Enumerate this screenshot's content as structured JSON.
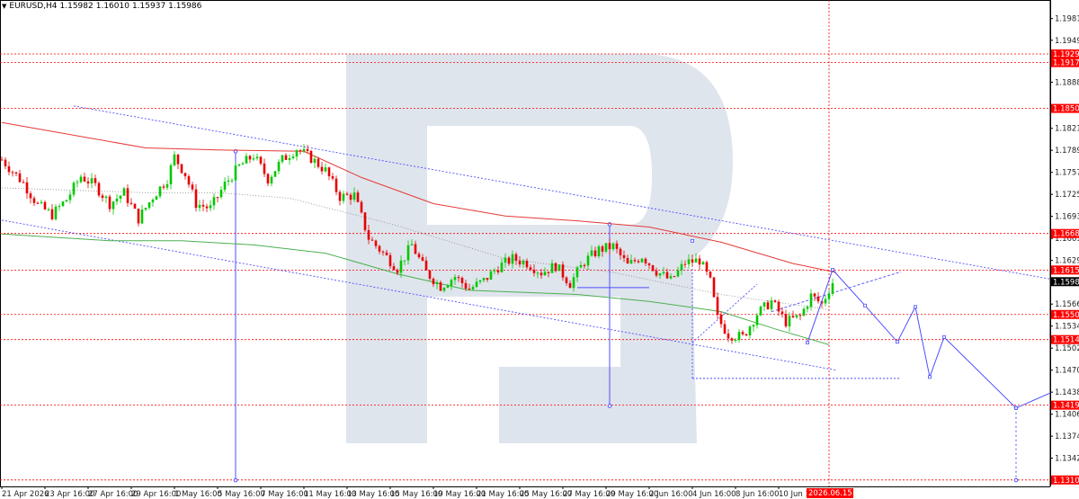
{
  "header": {
    "symbol": "EURUSD,H4",
    "open": "1.15982",
    "high": "1.16010",
    "low": "1.15937",
    "close": "1.15986"
  },
  "colors": {
    "bull": "#00c800",
    "bear": "#e60000",
    "ma_red": "#e53935",
    "ma_green": "#4caf50",
    "forecast": "#4d4dff",
    "level": "#ff0000",
    "watermark": "#d9e0ea",
    "grid": "#000000"
  },
  "icons": {
    "menu": "triangle-down-icon",
    "watermark": "logo-r-icon"
  },
  "chart_data": {
    "type": "candlestick",
    "y_ticks": [
      "1.19810",
      "1.19495",
      "1.18885",
      "1.18215",
      "1.17895",
      "1.17575",
      "1.17255",
      "1.16935",
      "1.16615",
      "1.16295",
      "1.15660",
      "1.15340",
      "1.15020",
      "1.14700",
      "1.14380",
      "1.14060",
      "1.13740",
      "1.13420",
      "1.13100"
    ],
    "y_tick_values": [
      1.1981,
      1.19495,
      1.18885,
      1.18215,
      1.17895,
      1.17575,
      1.17255,
      1.16935,
      1.16615,
      1.16295,
      1.1566,
      1.1534,
      1.1502,
      1.147,
      1.1438,
      1.1406,
      1.1374,
      1.1342,
      1.131
    ],
    "x_ticks": [
      "21 Apr 2026",
      "23 Apr 16:00",
      "27 Apr 16:00",
      "29 Apr 16:00",
      "1 May 16:00",
      "5 May 16:00",
      "7 May 16:00",
      "11 May 16:00",
      "13 May 16:00",
      "15 May 16:00",
      "19 May 16:00",
      "21 May 16:00",
      "25 May 16:00",
      "27 May 16:00",
      "29 May 16:00",
      "2 Jun 16:00",
      "4 Jun 16:00",
      "8 Jun 16:00",
      "10 Jun 16:00"
    ],
    "x_tick_bars": [
      0,
      12,
      24,
      36,
      48,
      60,
      72,
      84,
      96,
      108,
      120,
      132,
      144,
      156,
      168,
      180,
      192,
      204,
      216
    ],
    "cursor_label": "2026.06.15 00:00",
    "cursor_bar": 230,
    "levels": [
      {
        "price": 1.19296,
        "label": "1.19296"
      },
      {
        "price": 1.1917,
        "label": "1.19170"
      },
      {
        "price": 1.18504,
        "label": "1.18504"
      },
      {
        "price": 1.16686,
        "label": "1.16686"
      },
      {
        "price": 1.16155,
        "label": "1.16155"
      },
      {
        "price": 1.15509,
        "label": "1.15509"
      },
      {
        "price": 1.15144,
        "label": "1.15144"
      },
      {
        "price": 1.14191,
        "label": "1.14191"
      },
      {
        "price": 1.13104,
        "label": "1.13104"
      }
    ],
    "current_price": {
      "price": 1.15986,
      "label": "1.15986"
    },
    "ylim": [
      1.1301,
      1.2008
    ],
    "bars_visible": 292,
    "key_closes": [
      [
        0,
        1.1776
      ],
      [
        6,
        1.1742
      ],
      [
        10,
        1.171
      ],
      [
        14,
        1.1696
      ],
      [
        18,
        1.1718
      ],
      [
        22,
        1.1752
      ],
      [
        26,
        1.1738
      ],
      [
        30,
        1.1712
      ],
      [
        34,
        1.1728
      ],
      [
        38,
        1.169
      ],
      [
        42,
        1.1722
      ],
      [
        46,
        1.1748
      ],
      [
        48,
        1.178
      ],
      [
        51,
        1.1755
      ],
      [
        54,
        1.1712
      ],
      [
        58,
        1.1705
      ],
      [
        62,
        1.174
      ],
      [
        66,
        1.1766
      ],
      [
        70,
        1.1782
      ],
      [
        74,
        1.1748
      ],
      [
        78,
        1.1776
      ],
      [
        82,
        1.1792
      ],
      [
        86,
        1.1778
      ],
      [
        90,
        1.176
      ],
      [
        94,
        1.1722
      ],
      [
        98,
        1.1724
      ],
      [
        102,
        1.1662
      ],
      [
        106,
        1.164
      ],
      [
        110,
        1.1618
      ],
      [
        114,
        1.1652
      ],
      [
        118,
        1.1612
      ],
      [
        122,
        1.1592
      ],
      [
        126,
        1.1606
      ],
      [
        130,
        1.1588
      ],
      [
        134,
        1.16
      ],
      [
        138,
        1.162
      ],
      [
        142,
        1.1632
      ],
      [
        146,
        1.1626
      ],
      [
        150,
        1.1612
      ],
      [
        154,
        1.1622
      ],
      [
        158,
        1.1596
      ],
      [
        162,
        1.1628
      ],
      [
        166,
        1.1645
      ],
      [
        170,
        1.165
      ],
      [
        174,
        1.1622
      ],
      [
        178,
        1.1636
      ],
      [
        182,
        1.1614
      ],
      [
        186,
        1.16
      ],
      [
        190,
        1.1626
      ],
      [
        194,
        1.163
      ],
      [
        197,
        1.1598
      ],
      [
        199,
        1.1545
      ],
      [
        202,
        1.1522
      ],
      [
        206,
        1.1518
      ],
      [
        210,
        1.1552
      ],
      [
        214,
        1.157
      ],
      [
        218,
        1.154
      ],
      [
        222,
        1.1548
      ],
      [
        225,
        1.1578
      ],
      [
        228,
        1.1566
      ],
      [
        231,
        1.1598
      ]
    ],
    "moving_averages": [
      {
        "color_key": "ma_red",
        "points": [
          [
            0,
            1.183
          ],
          [
            40,
            1.1793
          ],
          [
            60,
            1.179
          ],
          [
            84,
            1.1788
          ],
          [
            100,
            1.175
          ],
          [
            120,
            1.1712
          ],
          [
            140,
            1.1694
          ],
          [
            160,
            1.1687
          ],
          [
            180,
            1.1678
          ],
          [
            200,
            1.1656
          ],
          [
            220,
            1.1625
          ],
          [
            232,
            1.1612
          ]
        ]
      },
      {
        "color_key": "ma_green",
        "points": [
          [
            0,
            1.1668
          ],
          [
            30,
            1.1658
          ],
          [
            50,
            1.1658
          ],
          [
            70,
            1.1652
          ],
          [
            90,
            1.164
          ],
          [
            110,
            1.161
          ],
          [
            130,
            1.1586
          ],
          [
            160,
            1.158
          ],
          [
            180,
            1.157
          ],
          [
            200,
            1.1555
          ],
          [
            215,
            1.153
          ],
          [
            230,
            1.1507
          ]
        ]
      },
      {
        "color_key": "forecast",
        "dotted": true,
        "points": [
          [
            0,
            1.1735
          ],
          [
            40,
            1.1728
          ],
          [
            60,
            1.1728
          ],
          [
            80,
            1.172
          ],
          [
            110,
            1.168
          ],
          [
            140,
            1.1632
          ],
          [
            170,
            1.1612
          ],
          [
            200,
            1.158
          ],
          [
            230,
            1.1558
          ]
        ]
      }
    ],
    "channel_lines": [
      {
        "points": [
          [
            20,
            1.1854
          ],
          [
            292,
            1.1602
          ]
        ]
      },
      {
        "points": [
          [
            0,
            1.1688
          ],
          [
            232,
            1.147
          ]
        ]
      }
    ],
    "forecast_path": [
      [
        224,
        1.151
      ],
      [
        231,
        1.1616
      ],
      [
        240,
        1.1564
      ],
      [
        249,
        1.1511
      ],
      [
        254,
        1.1562
      ],
      [
        258,
        1.146
      ],
      [
        262,
        1.1518
      ],
      [
        282,
        1.1415
      ],
      [
        292,
        1.1438
      ]
    ],
    "triangle_top": [
      [
        214,
        1.1555
      ],
      [
        232,
        1.1582
      ],
      [
        250,
        1.1613
      ]
    ],
    "triangle_base": [
      [
        192,
        1.1458
      ],
      [
        250,
        1.1458
      ]
    ],
    "triangle_sides": [
      [
        [
          192,
          1.1458
        ],
        [
          192,
          1.1628
        ]
      ],
      [
        [
          192,
          1.151
        ],
        [
          210,
          1.1595
        ]
      ]
    ],
    "markers": [
      [
        224,
        1.151
      ],
      [
        231,
        1.1616
      ],
      [
        240,
        1.1564
      ],
      [
        249,
        1.1511
      ],
      [
        254,
        1.1562
      ],
      [
        258,
        1.146
      ],
      [
        262,
        1.1518
      ],
      [
        282,
        1.1415
      ],
      [
        192,
        1.1658
      ]
    ],
    "vertical_lines": [
      {
        "bar": 65,
        "from": 1.1788,
        "to": 1.131
      },
      {
        "bar": 169,
        "from": 1.1682,
        "to": 1.1418
      },
      {
        "bar": 282,
        "from": 1.1415,
        "to": 1.131
      }
    ],
    "fib_box": [
      [
        160,
        1.159
      ],
      [
        180,
        1.159
      ]
    ],
    "fib_anchor": [
      [
        65,
        1.1548
      ],
      [
        169,
        1.1548
      ]
    ]
  }
}
